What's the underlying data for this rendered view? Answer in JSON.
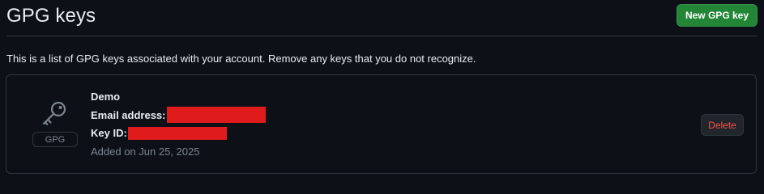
{
  "header": {
    "title": "GPG keys",
    "new_key_label": "New GPG key"
  },
  "description": "This is a list of GPG keys associated with your account. Remove any keys that you do not recognize.",
  "key": {
    "icon": "key-icon",
    "type_badge": "GPG",
    "name": "Demo",
    "email_label": "Email address:",
    "key_id_label": "Key ID:",
    "added_on": "Added on Jun 25, 2025",
    "delete_label": "Delete"
  },
  "colors": {
    "background": "#0d1117",
    "primary_button": "#238636",
    "danger_text": "#f85149",
    "redaction": "#e01b1b",
    "border": "#30363d",
    "muted_text": "#7d8590"
  }
}
